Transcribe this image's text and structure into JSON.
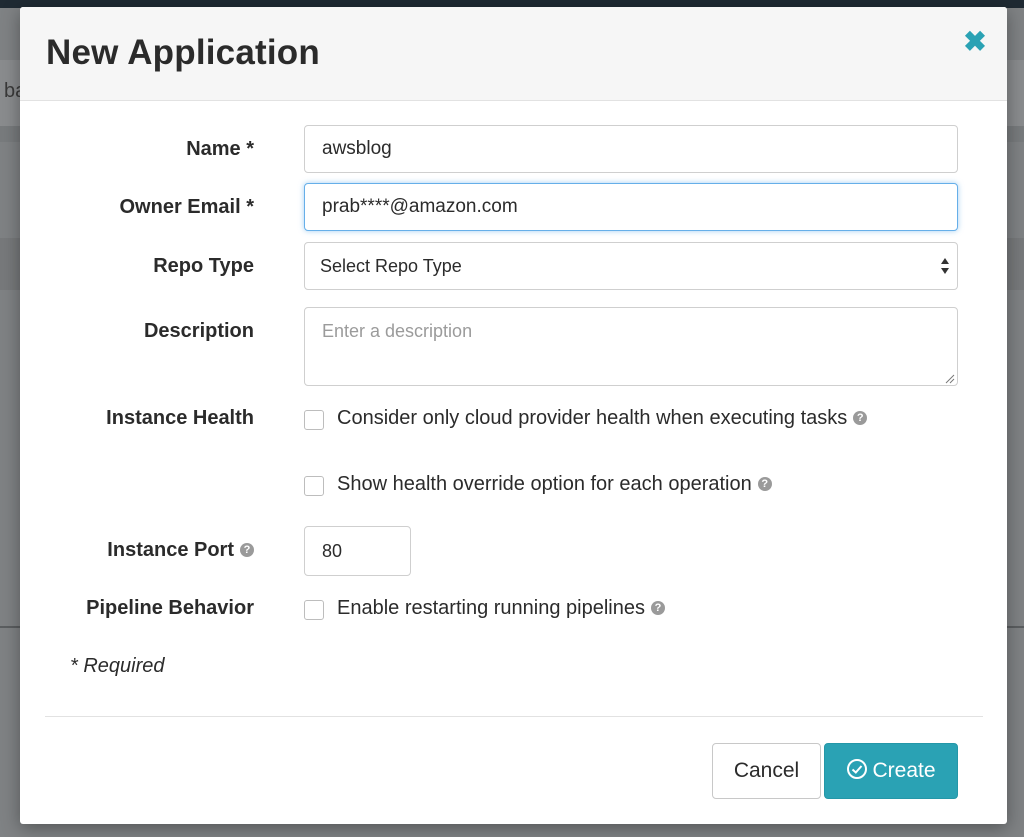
{
  "background": {
    "partial_text": "ba"
  },
  "modal": {
    "title": "New Application",
    "close_icon": "close-icon"
  },
  "form": {
    "name": {
      "label": "Name *",
      "value": "awsblog"
    },
    "owner_email": {
      "label": "Owner Email *",
      "value": "prab****@amazon.com"
    },
    "repo_type": {
      "label": "Repo Type",
      "selected": "Select Repo Type"
    },
    "description": {
      "label": "Description",
      "placeholder": "Enter a description",
      "value": ""
    },
    "instance_health": {
      "label": "Instance Health",
      "options": [
        {
          "label": "Consider only cloud provider health when executing tasks",
          "checked": false
        },
        {
          "label": "Show health override option for each operation",
          "checked": false
        }
      ]
    },
    "instance_port": {
      "label": "Instance Port",
      "value": "80"
    },
    "pipeline_behavior": {
      "label": "Pipeline Behavior",
      "option": {
        "label": "Enable restarting running pipelines",
        "checked": false
      }
    },
    "required_note": "* Required"
  },
  "footer": {
    "cancel_label": "Cancel",
    "create_label": "Create"
  },
  "colors": {
    "accent": "#2aa2b4",
    "focus": "#66afe9"
  }
}
